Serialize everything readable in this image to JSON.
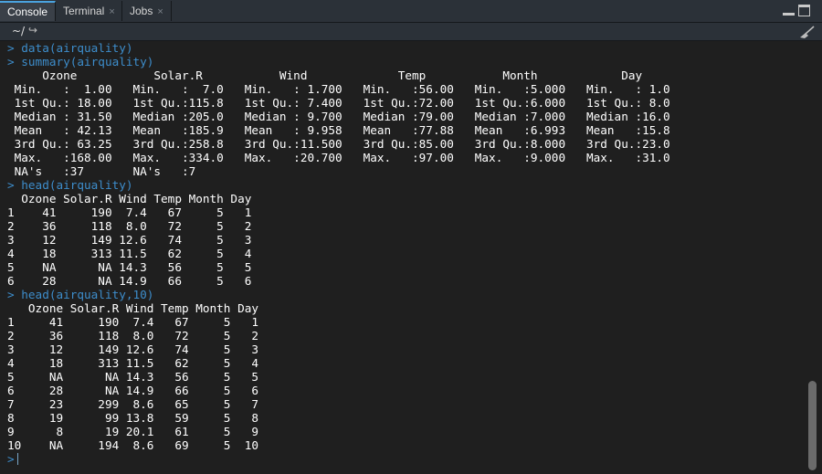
{
  "tabs": [
    {
      "label": "Console",
      "closable": false,
      "active": true
    },
    {
      "label": "Terminal",
      "closable": true,
      "active": false
    },
    {
      "label": "Jobs",
      "closable": true,
      "active": false
    }
  ],
  "close_glyph": "×",
  "path": "~/",
  "path_arrow": "↪",
  "prompt": ">",
  "commands": {
    "c1": "data(airquality)",
    "c2": "summary(airquality)",
    "c3": "head(airquality)",
    "c4": "head(airquality,10)"
  },
  "summary_output": [
    "     Ozone           Solar.R           Wind             Temp           Month            Day      ",
    " Min.   :  1.00   Min.   :  7.0   Min.   : 1.700   Min.   :56.00   Min.   :5.000   Min.   : 1.0  ",
    " 1st Qu.: 18.00   1st Qu.:115.8   1st Qu.: 7.400   1st Qu.:72.00   1st Qu.:6.000   1st Qu.: 8.0  ",
    " Median : 31.50   Median :205.0   Median : 9.700   Median :79.00   Median :7.000   Median :16.0  ",
    " Mean   : 42.13   Mean   :185.9   Mean   : 9.958   Mean   :77.88   Mean   :6.993   Mean   :15.8  ",
    " 3rd Qu.: 63.25   3rd Qu.:258.8   3rd Qu.:11.500   3rd Qu.:85.00   3rd Qu.:8.000   3rd Qu.:23.0  ",
    " Max.   :168.00   Max.   :334.0   Max.   :20.700   Max.   :97.00   Max.   :9.000   Max.   :31.0  ",
    " NA's   :37       NA's   :7                                                                       "
  ],
  "head6_output": [
    "  Ozone Solar.R Wind Temp Month Day",
    "1    41     190  7.4   67     5   1",
    "2    36     118  8.0   72     5   2",
    "3    12     149 12.6   74     5   3",
    "4    18     313 11.5   62     5   4",
    "5    NA      NA 14.3   56     5   5",
    "6    28      NA 14.9   66     5   6"
  ],
  "head10_output": [
    "   Ozone Solar.R Wind Temp Month Day",
    "1     41     190  7.4   67     5   1",
    "2     36     118  8.0   72     5   2",
    "3     12     149 12.6   74     5   3",
    "4     18     313 11.5   62     5   4",
    "5     NA      NA 14.3   56     5   5",
    "6     28      NA 14.9   66     5   6",
    "7     23     299  8.6   65     5   7",
    "8     19      99 13.8   59     5   8",
    "9      8      19 20.1   61     5   9",
    "10    NA     194  8.6   69     5  10"
  ],
  "colors": {
    "background": "#1f1f1f",
    "command": "#3d8dcb",
    "output": "#ffffff",
    "tab_accent": "#4aa3df"
  },
  "icons": {
    "minimize": "minimize-icon",
    "maximize": "maximize-icon",
    "clear": "broom-icon",
    "path_arrow": "go-to-directory-icon"
  }
}
